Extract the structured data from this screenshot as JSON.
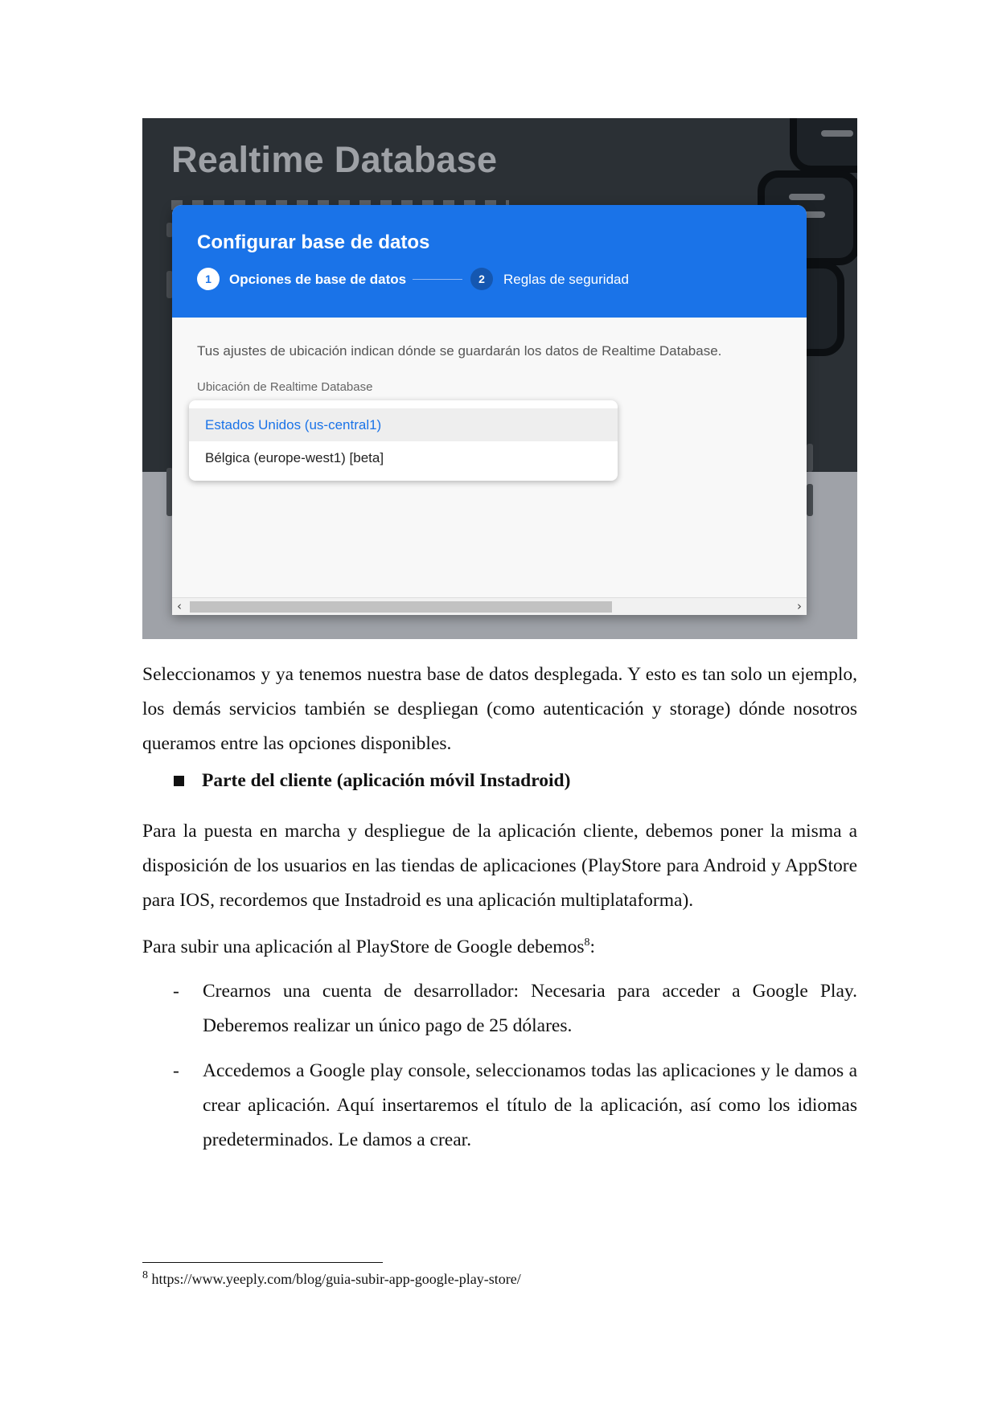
{
  "screenshot": {
    "bg_title": "Realtime Database",
    "dialog": {
      "title": "Configurar base de datos",
      "steps": [
        {
          "number": "1",
          "label": "Opciones de base de datos"
        },
        {
          "number": "2",
          "label": "Reglas de seguridad"
        }
      ],
      "description": "Tus ajustes de ubicación indican dónde se guardarán los datos de Realtime Database.",
      "field_label": "Ubicación de Realtime Database",
      "options": [
        {
          "label": "Estados Unidos (us-central1)",
          "selected": true
        },
        {
          "label": "Bélgica (europe-west1) [beta]",
          "selected": false
        }
      ]
    },
    "colors": {
      "accent": "#1a73e8",
      "dark_bg": "#2b3035"
    }
  },
  "body": {
    "para1": "Seleccionamos y ya tenemos nuestra base de datos desplegada. Y esto es tan solo un ejemplo, los demás servicios también se despliegan (como autenticación y storage) dónde nosotros queramos entre las opciones disponibles.",
    "heading": "Parte del cliente (aplicación móvil Instadroid)",
    "para2": "Para la puesta en marcha y despliegue de la aplicación cliente, debemos poner la misma a disposición de los usuarios en las tiendas de aplicaciones (PlayStore para Android y AppStore para IOS, recordemos que Instadroid es una aplicación multiplataforma).",
    "para3": "Para subir una aplicación al PlayStore de Google debemos",
    "para3_footnote_ref": "8",
    "para3_end": ":",
    "list": [
      "Crearnos una cuenta de desarrollador: Necesaria para acceder a Google Play. Deberemos realizar un único pago de 25 dólares.",
      "Accedemos a Google play console, seleccionamos todas las aplicaciones y le damos a crear aplicación. Aquí insertaremos el título de la aplicación, así como los idiomas predeterminados. Le damos a crear."
    ],
    "list_marker": "-"
  },
  "footnote": {
    "number": "8",
    "text": " https://www.yeeply.com/blog/guia-subir-app-google-play-store/"
  }
}
